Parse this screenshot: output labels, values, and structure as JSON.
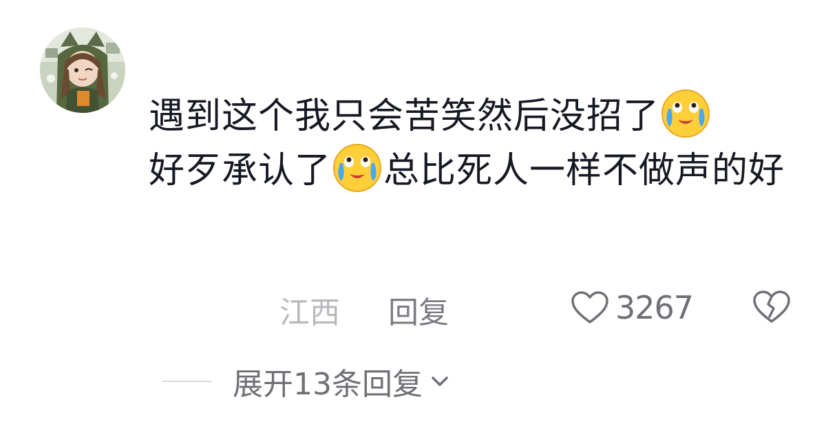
{
  "comment": {
    "avatar_icon": "avatar-girl-illustration",
    "text_part1": "遇到这个我只会苦笑然后没招了",
    "emoji1": "crying-laughing-emoji",
    "text_part2": "好歹承认了",
    "emoji2": "crying-laughing-emoji",
    "text_part3": "总比死人一样不做声的好",
    "location": "江西",
    "reply_label": "回复",
    "like_icon": "heart-outline-icon",
    "like_count": "3267",
    "dislike_icon": "broken-heart-icon",
    "expand_label": "展开13条回复",
    "expand_icon": "chevron-down-icon"
  },
  "colors": {
    "text": "#161823",
    "secondary": "#6f7076",
    "location": "#b8b9bd",
    "emoji_face": "#ffcf3a"
  }
}
